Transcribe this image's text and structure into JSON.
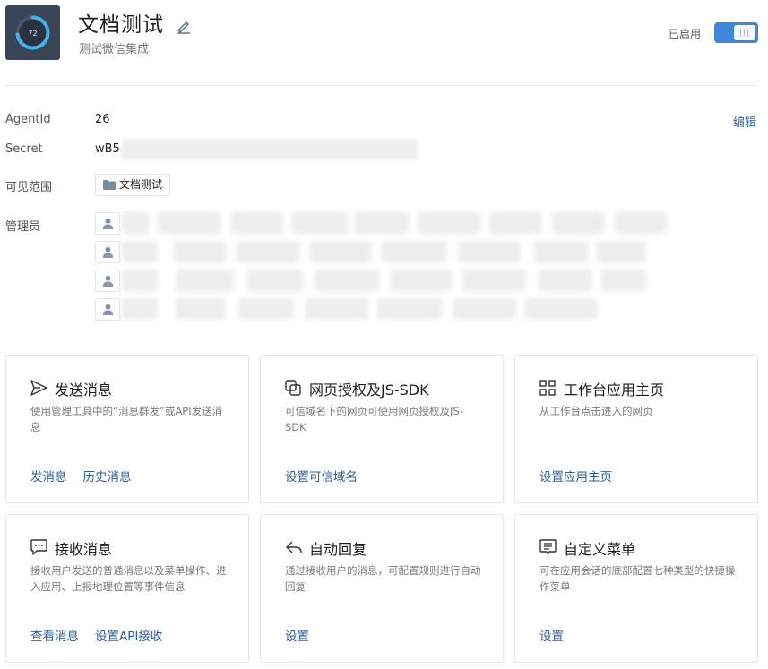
{
  "header": {
    "app_icon_value": "72",
    "app_name": "文档测试",
    "app_desc": "测试微信集成",
    "status_label": "已启用",
    "enabled": true
  },
  "info": {
    "agentid_label": "AgentId",
    "agentid_value": "26",
    "edit_label": "编辑",
    "secret_label": "Secret",
    "secret_value": "wB5",
    "scope_label": "可见范围",
    "scope_value": "文档测试",
    "admin_label": "管理员"
  },
  "cards": [
    {
      "title": "发送消息",
      "desc": "使用管理工具中的“消息群发”或API发送消息",
      "links": [
        "发消息",
        "历史消息"
      ],
      "icon": "send-icon"
    },
    {
      "title": "网页授权及JS-SDK",
      "desc": "可信域名下的网页可使用网页授权及JS-SDK",
      "links": [
        "设置可信域名"
      ],
      "icon": "web-auth-icon"
    },
    {
      "title": "工作台应用主页",
      "desc": "从工作台点击进入的网页",
      "links": [
        "设置应用主页"
      ],
      "icon": "grid-icon"
    },
    {
      "title": "接收消息",
      "desc": "接收用户发送的普通消息以及菜单操作、进入应用、上报地理位置等事件信息",
      "links": [
        "查看消息",
        "设置API接收"
      ],
      "icon": "chat-icon"
    },
    {
      "title": "自动回复",
      "desc": "通过接收用户的消息，可配置规则进行自动回复",
      "links": [
        "设置"
      ],
      "icon": "reply-icon"
    },
    {
      "title": "自定义菜单",
      "desc": "可在应用会话的底部配置七种类型的快捷操作菜单",
      "links": [
        "设置"
      ],
      "icon": "menu-icon"
    }
  ],
  "colors": {
    "accent": "#3e86d9",
    "link": "#2f5d97",
    "app_icon_bg": "#3a4658"
  }
}
